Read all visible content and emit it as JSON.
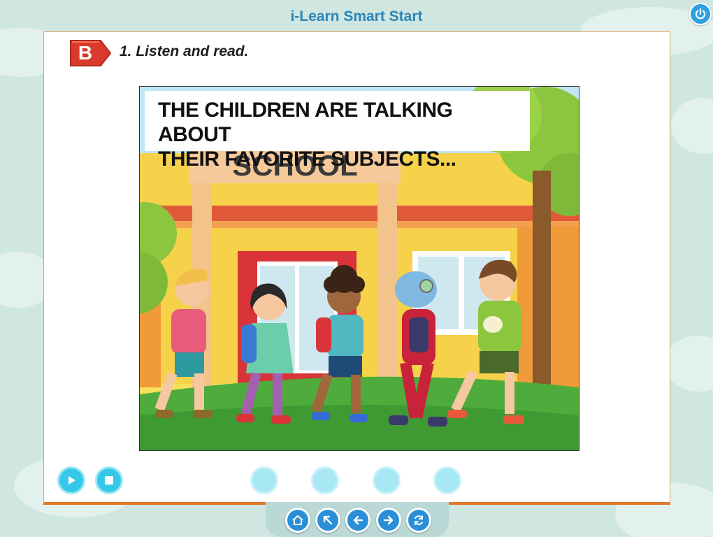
{
  "app": {
    "title": "i-Learn Smart Start"
  },
  "section": {
    "letter": "B",
    "instruction": "1. Listen and read."
  },
  "illustration": {
    "caption_line1": "THE CHILDREN ARE TALKING ABOUT",
    "caption_line2": "THEIR FAVORITE SUBJECTS...",
    "sign_text": "SCHOOL"
  },
  "icons": {
    "power": "power-icon",
    "play": "play-icon",
    "stop": "stop-icon",
    "home": "home-icon",
    "back_to_menu": "arrow-up-left-icon",
    "previous": "arrow-left-icon",
    "next": "arrow-right-icon",
    "replay": "refresh-icon"
  },
  "page_dots": 4,
  "colors": {
    "accent": "#35c8e8",
    "title": "#2b86b8",
    "badge": "#d93a2b",
    "panel_border": "#e07a2a",
    "nav_button": "#2a8fd8"
  }
}
